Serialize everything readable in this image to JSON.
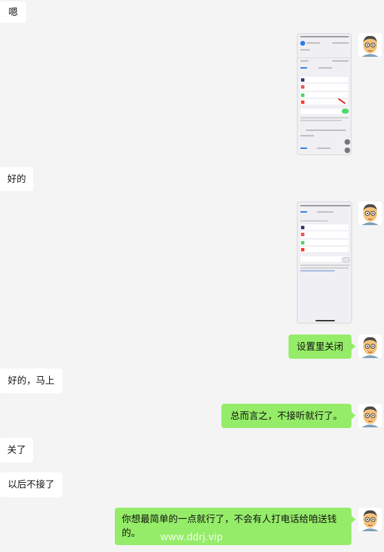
{
  "messages": [
    {
      "side": "left",
      "text": "嗯"
    },
    {
      "side": "right",
      "type": "image",
      "text": ""
    },
    {
      "side": "left",
      "text": "好的"
    },
    {
      "side": "right",
      "type": "image",
      "text": ""
    },
    {
      "side": "right",
      "text": "设置里关闭"
    },
    {
      "side": "left",
      "text": "好的，马上"
    },
    {
      "side": "right",
      "text": "总而言之，不接听就行了。"
    },
    {
      "side": "left",
      "text": "关了"
    },
    {
      "side": "left",
      "text": "以后不接了"
    },
    {
      "side": "right",
      "text": "你想最简单的一点就行了，不会有人打电话给咱送钱的。"
    }
  ],
  "watermark": "www.ddrj.vip",
  "colors": {
    "background": "#f4f4f4",
    "left_bubble": "#ffffff",
    "right_bubble": "#95ec69"
  },
  "icons": {
    "avatar": "cartoon-man-avatar-icon"
  }
}
